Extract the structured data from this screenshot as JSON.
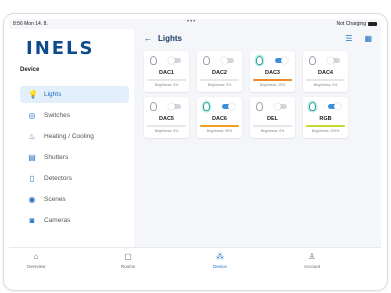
{
  "status": {
    "time": "8:56  Mon 14. 8.",
    "right": "Not Charging",
    "dots": "•••"
  },
  "brand": {
    "logo_main": "INELS",
    "accent": "#30b0e6"
  },
  "sidebar": {
    "section": "Device",
    "items": [
      {
        "label": "Lights",
        "icon": "bulb-icon",
        "active": true
      },
      {
        "label": "Switches",
        "icon": "switch-icon"
      },
      {
        "label": "Heating / Cooling",
        "icon": "heating-icon"
      },
      {
        "label": "Shutters",
        "icon": "shutters-icon"
      },
      {
        "label": "Detectors",
        "icon": "detector-icon"
      },
      {
        "label": "Scenes",
        "icon": "scenes-icon"
      },
      {
        "label": "Cameras",
        "icon": "camera-icon"
      }
    ]
  },
  "header": {
    "back": "←",
    "title": "Lights",
    "list_icon": "☰",
    "grid_icon": "▦"
  },
  "cards": [
    {
      "name": "DAC1",
      "on": false,
      "brightness": "Brightness: 0%",
      "level": 0,
      "color": "#cccccc"
    },
    {
      "name": "DAC2",
      "on": false,
      "brightness": "Brightness: 0%",
      "level": 0,
      "color": "#cccccc"
    },
    {
      "name": "DAC3",
      "on": true,
      "brightness": "Brightness: 25%",
      "level": 1,
      "color": "#f08a24"
    },
    {
      "name": "DAC4",
      "on": false,
      "brightness": "Brightness: 0%",
      "level": 0,
      "color": "#cccccc"
    },
    {
      "name": "DAC5",
      "on": false,
      "brightness": "Brightness: 0%",
      "level": 0,
      "color": "#cccccc"
    },
    {
      "name": "DAC6",
      "on": true,
      "brightness": "Brightness: 50%",
      "level": 1,
      "color": "#f0a020"
    },
    {
      "name": "DEL",
      "on": false,
      "brightness": "Brightness: 0%",
      "level": 0,
      "color": "#cccccc"
    },
    {
      "name": "RGB",
      "on": true,
      "brightness": "Brightness: 100%",
      "level": 1,
      "color": "#c6d930"
    }
  ],
  "tabs": [
    {
      "label": "Overview",
      "icon": "home-icon",
      "glyph": "⌂"
    },
    {
      "label": "Rooms",
      "icon": "rooms-icon",
      "glyph": "▢"
    },
    {
      "label": "Device",
      "icon": "device-icon",
      "glyph": "⁂",
      "active": true
    },
    {
      "label": "Account",
      "icon": "account-icon",
      "glyph": "♙"
    }
  ]
}
